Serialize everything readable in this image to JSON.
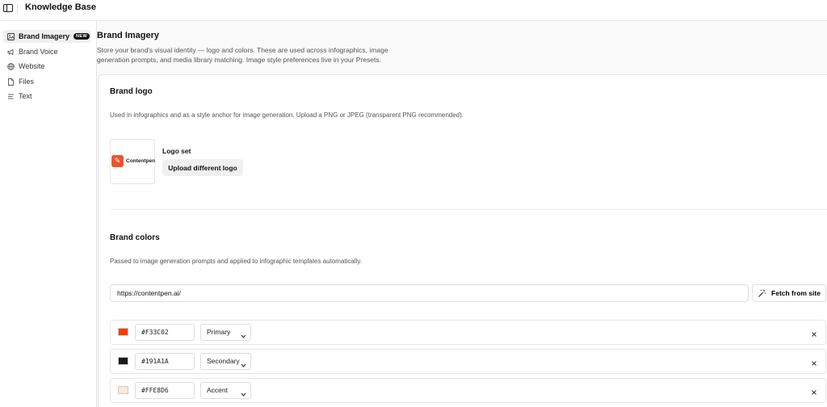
{
  "app": {
    "title": "Knowledge Base"
  },
  "sidebar": {
    "items": [
      {
        "label": "Brand Imagery",
        "icon": "image-icon",
        "badge": "NEW",
        "active": true
      },
      {
        "label": "Brand Voice",
        "icon": "megaphone-icon"
      },
      {
        "label": "Website",
        "icon": "globe-icon"
      },
      {
        "label": "Files",
        "icon": "file-icon"
      },
      {
        "label": "Text",
        "icon": "text-icon"
      }
    ]
  },
  "page": {
    "title": "Brand Imagery",
    "description": "Store your brand's visual identity — logo and colors. These are used across infographics, image generation prompts, and media library matching. Image style preferences live in your Presets."
  },
  "logo_section": {
    "title": "Brand logo",
    "description": "Used in infographics and as a style anchor for image generation. Upload a PNG or JPEG (transparent PNG recommended).",
    "logo_wordmark": "Contentpen",
    "status": "Logo set",
    "upload_button": "Upload different logo"
  },
  "colors_section": {
    "title": "Brand colors",
    "description": "Passed to image generation prompts and applied to infographic templates automatically.",
    "url_value": "https://contentpen.ai/",
    "fetch_button": "Fetch from site",
    "colors": [
      {
        "hex": "#F33C02",
        "role": "Primary"
      },
      {
        "hex": "#191A1A",
        "role": "Secondary"
      },
      {
        "hex": "#FFE8D6",
        "role": "Accent"
      }
    ]
  }
}
